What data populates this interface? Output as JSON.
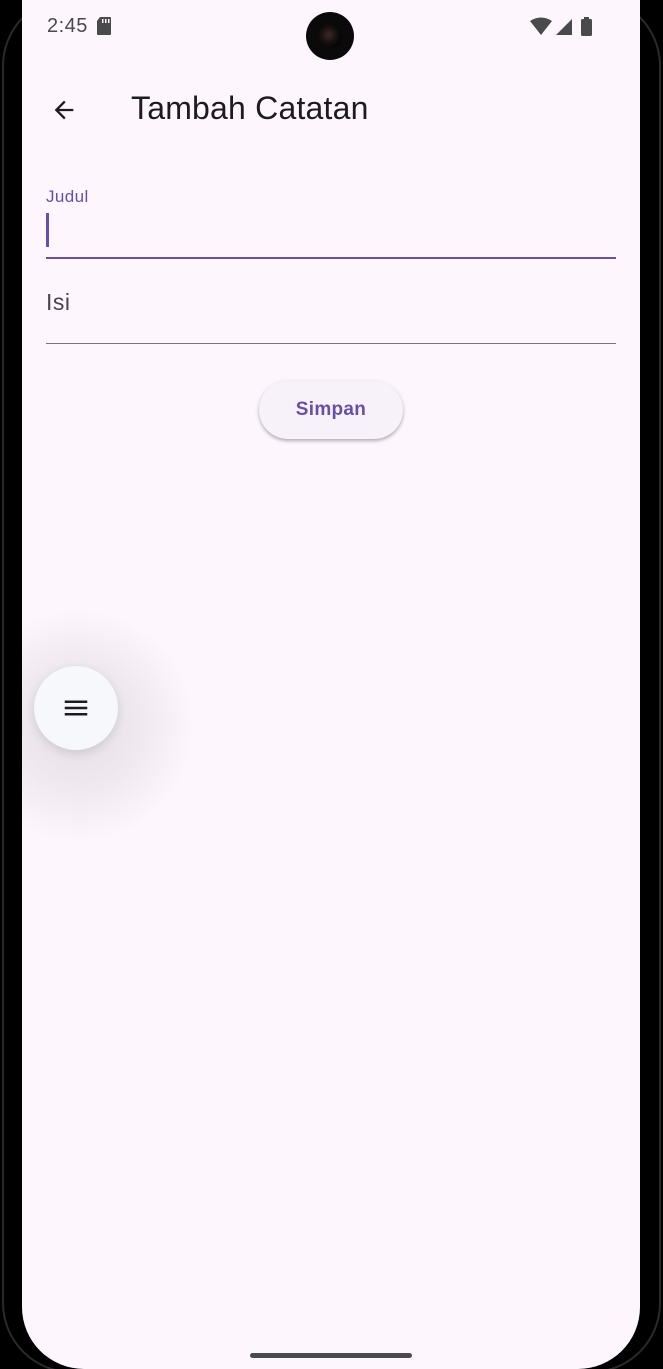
{
  "status_bar": {
    "time": "2:45",
    "icons": [
      "sd-card-icon",
      "wifi-icon",
      "cellular-signal-icon",
      "battery-icon"
    ]
  },
  "app_bar": {
    "back_icon": "arrow-back-icon",
    "title": "Tambah Catatan"
  },
  "form": {
    "judul": {
      "label": "Judul",
      "value": ""
    },
    "isi": {
      "placeholder": "Isi",
      "value": ""
    },
    "submit_label": "Simpan"
  },
  "fab": {
    "icon": "menu-icon"
  },
  "colors": {
    "primary": "#6750a4",
    "background": "#fdf7fd",
    "on_surface": "#1d1b20",
    "button_surface": "#f7f2fa"
  }
}
